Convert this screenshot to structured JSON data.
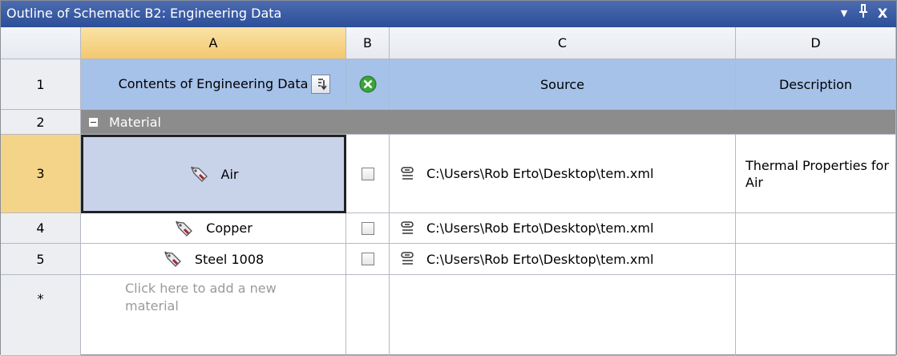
{
  "window": {
    "title": "Outline of Schematic B2: Engineering Data",
    "buttons": {
      "dropdown": "▼",
      "pin": "ᵽ",
      "close": "X"
    }
  },
  "columns": [
    "A",
    "B",
    "C",
    "D"
  ],
  "header_row": {
    "row_label": "1",
    "contents": "Contents of Engineering Data",
    "source": "Source",
    "description": "Description"
  },
  "group_row": {
    "row_label": "2",
    "label": "Material",
    "toggle": "−"
  },
  "materials": [
    {
      "row_label": "3",
      "name": "Air",
      "source": "C:\\Users\\Rob Erto\\Desktop\\tem.xml",
      "description": "Thermal Properties for Air",
      "selected": true
    },
    {
      "row_label": "4",
      "name": "Copper",
      "source": "C:\\Users\\Rob Erto\\Desktop\\tem.xml",
      "description": "",
      "selected": false
    },
    {
      "row_label": "5",
      "name": "Steel 1008",
      "source": "C:\\Users\\Rob Erto\\Desktop\\tem.xml",
      "description": "",
      "selected": false
    }
  ],
  "new_row": {
    "row_label": "*",
    "placeholder": "Click here to add a new material"
  },
  "colors": {
    "title_bar": "#2c4f98",
    "header_blue": "#a6c2e9",
    "group_gray": "#8c8c8c",
    "selected_column": "#f2c870",
    "selected_cell": "#c8d3ea"
  }
}
